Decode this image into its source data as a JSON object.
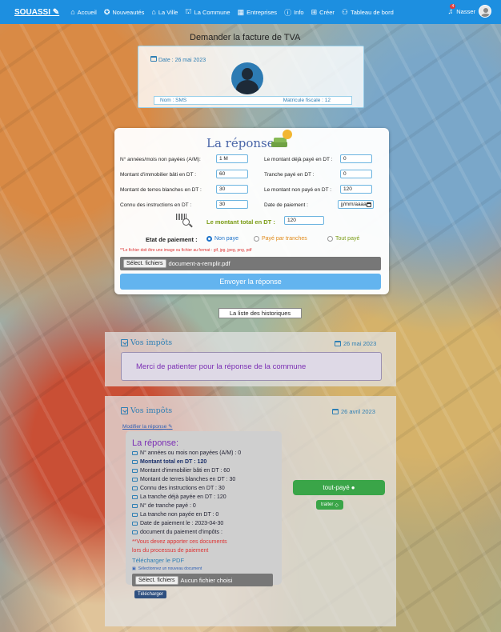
{
  "nav": {
    "brand": "SOUASSI",
    "items": [
      {
        "label": "Accueil",
        "icon": "home-icon"
      },
      {
        "label": "Nouveautés",
        "icon": "explore-icon"
      },
      {
        "label": "La Ville",
        "icon": "city-icon"
      },
      {
        "label": "La Commune",
        "icon": "bank-icon"
      },
      {
        "label": "Entreprises",
        "icon": "building-icon"
      },
      {
        "label": "Info",
        "icon": "info-icon"
      },
      {
        "label": "Créer",
        "icon": "plus-square-icon"
      },
      {
        "label": "Tableau de bord",
        "icon": "users-icon"
      }
    ],
    "notification_count": "4",
    "user_name": "Nasser"
  },
  "facture": {
    "title": "Demander la facture de TVA",
    "date_label": "Date : 26 mai 2023",
    "nom_label": "Nom : SMS",
    "matricule_label": "Matricule fiscale : 12"
  },
  "reponse_form": {
    "title": "La réponse",
    "fields": [
      {
        "label": "N° années/mois non payées (A/M):",
        "value": "1 M"
      },
      {
        "label": "Le montant déjà payé en DT :",
        "value": "0"
      },
      {
        "label": "Montant d'immobilier bâti en DT :",
        "value": "60"
      },
      {
        "label": "Tranche payé en DT :",
        "value": "0"
      },
      {
        "label": "Montant de terres blanches en DT :",
        "value": "30"
      },
      {
        "label": "Le montant non payé en DT :",
        "value": "120"
      },
      {
        "label": "Connu des instructions en DT :",
        "value": "30"
      },
      {
        "label": "Date de paiement :",
        "value": "jj/mm/aaaa"
      }
    ],
    "total_label": "Le montant total en DT :",
    "total_value": "120",
    "etat_label": "Etat de paiement :",
    "radios": [
      {
        "label": "Non paye",
        "color": "#1d72c9",
        "checked": true
      },
      {
        "label": "Payé par tranches",
        "color": "#e08a1a",
        "checked": false
      },
      {
        "label": "Tout payé",
        "color": "#7a9b14",
        "checked": false
      }
    ],
    "warning": "**Le fichier doit être une image ou fichier au format : gif, jpg, jpeg, png, pdf",
    "file_button": "Sélect. fichiers",
    "file_name": "document-a-remplir.pdf",
    "submit": "Envoyer la réponse"
  },
  "history_label": "La liste des historiques",
  "impots1": {
    "title": "Vos impôts",
    "date": "26 mai 2023",
    "message": "Merci de patienter pour la réponse de la commune"
  },
  "impots2": {
    "title": "Vos impôts",
    "date": "26 avril 2023",
    "modify_link": "Modifier la réponse",
    "reponse_title": "La réponse:",
    "lines": [
      "N° années ou mois non payées (A/M) : 0",
      "Montant total en DT : 120",
      "Montant d'immobilier bâti en DT : 60",
      "Montant de terres blanches en DT : 30",
      "Connu des instructions en DT : 30",
      "La tranche déjà payée en DT : 120",
      "N° de tranche payé : 0",
      "La tranche non payée en DT : 0",
      "Date de paiement le : 2023-04-30",
      "document du paiement d'impôts :"
    ],
    "red_note_1": "**Vous devez apporter ces documents",
    "red_note_2": "lors du processus de paiement",
    "download_pdf": "Télécharger le PDF",
    "new_doc": "Sélectionnez un nouveau document",
    "file_button": "Sélect. fichiers",
    "file_name": "Aucun fichier choisi",
    "upload_button": "Télécharger",
    "status_button": "tout-payé",
    "traiter_button": "traiter"
  },
  "colors": {
    "nav": "#1d8fe0",
    "accent_blue": "#2f7fb4",
    "purple": "#7b2fb4",
    "green": "#3aa548",
    "red": "#dd3333"
  }
}
